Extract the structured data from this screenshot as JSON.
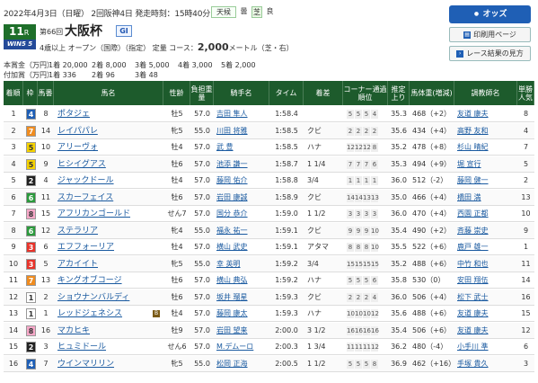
{
  "header": {
    "date_line": "2022年4月3日（日曜） 2回阪神4日 発走時刻：15時40分",
    "weather_label": "天候",
    "weather_value": "曇",
    "track_label": "芝",
    "track_value": "良",
    "race_badge_num": "11",
    "race_badge_unit": "R",
    "win5_label": "WIN5 5",
    "race_number_text": "第66回",
    "race_name": "大阪杯",
    "grade": "GI",
    "conditions": "4歳以上 オープン（国際）（指定） 定量 コース：",
    "distance": "2,000",
    "distance_suffix": "メートル（芝・右）"
  },
  "buttons": {
    "odds": "オッズ",
    "print": "印刷用ページ",
    "result_guide": "レース結果の見方"
  },
  "prize": {
    "label": "本賞金（万円）",
    "items": [
      "1着 20,000",
      "2着 8,000",
      "3着 5,000",
      "4着 3,000",
      "5着 2,000"
    ],
    "label2": "付加賞（万円）",
    "items2": [
      "1着 336",
      "2着 96",
      "3着 48"
    ]
  },
  "table_headers": [
    "着順",
    "枠",
    "馬番",
    "馬名",
    "性齢",
    "負担重量",
    "騎手名",
    "タイム",
    "着差",
    "コーナー通過順位",
    "推定上り",
    "馬体重(増減)",
    "調教師名",
    "単勝人気"
  ],
  "gate_colors": {
    "1": {
      "bg": "#ffffff",
      "fg": "#333333"
    },
    "2": {
      "bg": "#222222",
      "fg": "#ffffff"
    },
    "3": {
      "bg": "#e8332a",
      "fg": "#ffffff"
    },
    "4": {
      "bg": "#1f5fb5",
      "fg": "#ffffff"
    },
    "5": {
      "bg": "#f5d200",
      "fg": "#333333"
    },
    "6": {
      "bg": "#2b9a3c",
      "fg": "#ffffff"
    },
    "7": {
      "bg": "#f08c1f",
      "fg": "#ffffff"
    },
    "8": {
      "bg": "#f6a8c8",
      "fg": "#333333"
    }
  },
  "rows": [
    {
      "rank": "1",
      "gate": "4",
      "num": "8",
      "horse": "ポタジェ",
      "sex": "牡5",
      "weight": "57.0",
      "jockey": "吉田 隼人",
      "time": "1:58.4",
      "margin": "",
      "corner": [
        "5",
        "5",
        "5",
        "4"
      ],
      "last": "35.3",
      "body": "468（+2）",
      "trainer": "友道 康夫",
      "pop": "8",
      "blinker": false
    },
    {
      "rank": "2",
      "gate": "7",
      "num": "14",
      "horse": "レイパパレ",
      "sex": "牝5",
      "weight": "55.0",
      "jockey": "川田 将雅",
      "time": "1:58.5",
      "margin": "クビ",
      "corner": [
        "2",
        "2",
        "2",
        "2"
      ],
      "last": "35.6",
      "body": "434（+4）",
      "trainer": "高野 友和",
      "pop": "4",
      "blinker": false
    },
    {
      "rank": "3",
      "gate": "5",
      "num": "10",
      "horse": "アリーヴォ",
      "sex": "牡4",
      "weight": "57.0",
      "jockey": "武 豊",
      "time": "1:58.5",
      "margin": "ハナ",
      "corner": [
        "12",
        "12",
        "12",
        "8"
      ],
      "last": "35.2",
      "body": "478（+8）",
      "trainer": "杉山 晴紀",
      "pop": "7",
      "blinker": false
    },
    {
      "rank": "4",
      "gate": "5",
      "num": "9",
      "horse": "ヒシイグアス",
      "sex": "牡6",
      "weight": "57.0",
      "jockey": "池添 謙一",
      "time": "1:58.7",
      "margin": "1 1/4",
      "corner": [
        "7",
        "7",
        "7",
        "6"
      ],
      "last": "35.3",
      "body": "494（+9）",
      "trainer": "堀 宣行",
      "pop": "5",
      "blinker": false
    },
    {
      "rank": "5",
      "gate": "2",
      "num": "4",
      "horse": "ジャックドール",
      "sex": "牡4",
      "weight": "57.0",
      "jockey": "藤岡 佑介",
      "time": "1:58.8",
      "margin": "3/4",
      "corner": [
        "1",
        "1",
        "1",
        "1"
      ],
      "last": "36.0",
      "body": "512（-2）",
      "trainer": "藤岡 健一",
      "pop": "2",
      "blinker": false
    },
    {
      "rank": "6",
      "gate": "6",
      "num": "11",
      "horse": "スカーフェイス",
      "sex": "牡6",
      "weight": "57.0",
      "jockey": "岩田 康誠",
      "time": "1:58.9",
      "margin": "クビ",
      "corner": [
        "14",
        "14",
        "13",
        "13"
      ],
      "last": "35.0",
      "body": "466（+4）",
      "trainer": "橋田 満",
      "pop": "13",
      "blinker": false
    },
    {
      "rank": "7",
      "gate": "8",
      "num": "15",
      "horse": "アフリカンゴールド",
      "sex": "せん7",
      "weight": "57.0",
      "jockey": "国分 恭介",
      "time": "1:59.0",
      "margin": "1 1/2",
      "corner": [
        "3",
        "3",
        "3",
        "3"
      ],
      "last": "36.0",
      "body": "470（+4）",
      "trainer": "西園 正都",
      "pop": "10",
      "blinker": false
    },
    {
      "rank": "8",
      "gate": "6",
      "num": "12",
      "horse": "ステラリア",
      "sex": "牝4",
      "weight": "55.0",
      "jockey": "福永 祐一",
      "time": "1:59.1",
      "margin": "クビ",
      "corner": [
        "9",
        "9",
        "9",
        "10"
      ],
      "last": "35.4",
      "body": "490（+2）",
      "trainer": "斉藤 崇史",
      "pop": "9",
      "blinker": false
    },
    {
      "rank": "9",
      "gate": "3",
      "num": "6",
      "horse": "エフフォーリア",
      "sex": "牡4",
      "weight": "57.0",
      "jockey": "横山 武史",
      "time": "1:59.1",
      "margin": "アタマ",
      "corner": [
        "8",
        "8",
        "8",
        "10"
      ],
      "last": "35.5",
      "body": "522（+6）",
      "trainer": "鹿戸 雄一",
      "pop": "1",
      "blinker": false
    },
    {
      "rank": "10",
      "gate": "3",
      "num": "5",
      "horse": "アカイイト",
      "sex": "牝5",
      "weight": "55.0",
      "jockey": "幸 英明",
      "time": "1:59.2",
      "margin": "3/4",
      "corner": [
        "15",
        "15",
        "15",
        "15"
      ],
      "last": "35.2",
      "body": "488（+6）",
      "trainer": "中竹 和也",
      "pop": "11",
      "blinker": false
    },
    {
      "rank": "11",
      "gate": "7",
      "num": "13",
      "horse": "キングオブコージ",
      "sex": "牡6",
      "weight": "57.0",
      "jockey": "横山 典弘",
      "time": "1:59.2",
      "margin": "ハナ",
      "corner": [
        "5",
        "5",
        "5",
        "6"
      ],
      "last": "35.8",
      "body": "530（0）",
      "trainer": "安田 翔伍",
      "pop": "14",
      "blinker": false
    },
    {
      "rank": "12",
      "gate": "1",
      "num": "2",
      "horse": "ショウナンバルディ",
      "sex": "牡6",
      "weight": "57.0",
      "jockey": "坂井 瑠星",
      "time": "1:59.3",
      "margin": "クビ",
      "corner": [
        "2",
        "2",
        "2",
        "4"
      ],
      "last": "36.0",
      "body": "506（+4）",
      "trainer": "松下 武士",
      "pop": "16",
      "blinker": false
    },
    {
      "rank": "13",
      "gate": "1",
      "num": "1",
      "horse": "レッドジェネシス",
      "sex": "牡4",
      "weight": "57.0",
      "jockey": "藤岡 康太",
      "time": "1:59.3",
      "margin": "ハナ",
      "corner": [
        "10",
        "10",
        "10",
        "12"
      ],
      "last": "35.6",
      "body": "488（+6）",
      "trainer": "友道 康夫",
      "pop": "15",
      "blinker": true
    },
    {
      "rank": "14",
      "gate": "8",
      "num": "16",
      "horse": "マカヒキ",
      "sex": "牡9",
      "weight": "57.0",
      "jockey": "岩田 望来",
      "time": "2:00.0",
      "margin": "3 1/2",
      "corner": [
        "16",
        "16",
        "16",
        "16"
      ],
      "last": "35.4",
      "body": "506（+6）",
      "trainer": "友道 康夫",
      "pop": "12",
      "blinker": false
    },
    {
      "rank": "15",
      "gate": "2",
      "num": "3",
      "horse": "ヒュミドール",
      "sex": "せん6",
      "weight": "57.0",
      "jockey": "M.デムーロ",
      "time": "2:00.3",
      "margin": "1 3/4",
      "corner": [
        "11",
        "11",
        "11",
        "12"
      ],
      "last": "36.2",
      "body": "480（-4）",
      "trainer": "小手川 準",
      "pop": "6",
      "blinker": false
    },
    {
      "rank": "16",
      "gate": "4",
      "num": "7",
      "horse": "ウインマリリン",
      "sex": "牝5",
      "weight": "55.0",
      "jockey": "松岡 正海",
      "time": "2:00.5",
      "margin": "1 1/2",
      "corner": [
        "5",
        "5",
        "5",
        "8"
      ],
      "last": "36.9",
      "body": "462（+16）",
      "trainer": "手塚 貴久",
      "pop": "3",
      "blinker": false
    }
  ]
}
